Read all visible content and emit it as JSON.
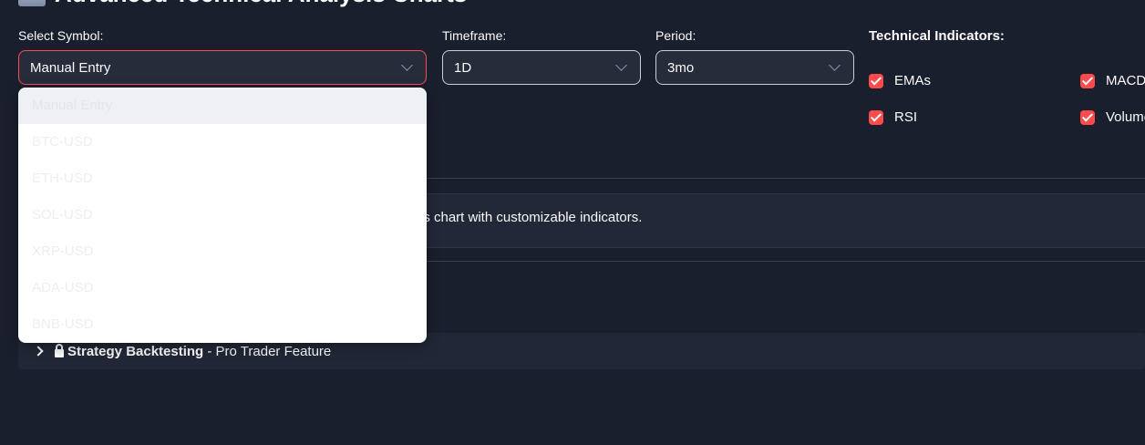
{
  "page": {
    "title": "Advanced Technical Analysis Charts",
    "title_icon": "chart-icon"
  },
  "controls": {
    "symbol_label": "Select Symbol:",
    "symbol_value": "Manual Entry",
    "timeframe_label": "Timeframe:",
    "timeframe_value": "1D",
    "period_label": "Period:",
    "period_value": "3mo"
  },
  "symbol_dropdown": {
    "options": [
      "Manual Entry",
      "BTC-USD",
      "ETH-USD",
      "SOL-USD",
      "XRP-USD",
      "ADA-USD",
      "BNB-USD"
    ],
    "selected_index": 0
  },
  "indicators": {
    "title": "Technical Indicators:",
    "items": [
      {
        "label": "EMAs",
        "checked": true
      },
      {
        "label": "MACD",
        "checked": true
      },
      {
        "label": "RSI",
        "checked": true
      },
      {
        "label": "Volume",
        "checked": true
      }
    ]
  },
  "info": {
    "text": "ysis chart with customizable indicators."
  },
  "expander": {
    "icon": "lock-icon",
    "title": "Strategy Backtesting",
    "subtitle": " - Pro Trader Feature"
  },
  "colors": {
    "accent": "#ff4b4b",
    "background": "#1a1f2e"
  }
}
